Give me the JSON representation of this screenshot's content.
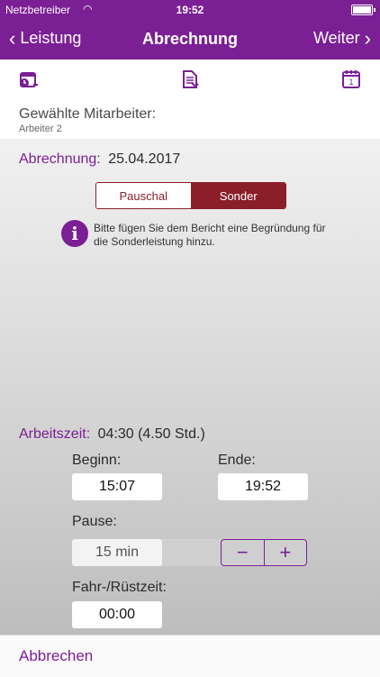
{
  "statusbar": {
    "carrier": "Netzbetreiber",
    "time": "19:52"
  },
  "nav": {
    "back_label": "Leistung",
    "title": "Abrechnung",
    "forward_label": "Weiter"
  },
  "toolbar": {
    "icons": [
      "calendar-clock-icon",
      "document-list-icon",
      "calendar-day-icon"
    ],
    "calendar_day_number": "1"
  },
  "selected_employees": {
    "label": "Gewählte Mitarbeiter:",
    "value": "Arbeiter 2"
  },
  "billing": {
    "label": "Abrechnung:",
    "date": "25.04.2017",
    "segments": [
      "Pauschal",
      "Sonder"
    ],
    "selected_segment": "Sonder",
    "info_text": "Bitte fügen Sie dem Bericht eine Begründung für die Sonderleistung hinzu."
  },
  "worktime": {
    "label": "Arbeitszeit:",
    "value": "04:30 (4.50 Std.)",
    "begin_label": "Beginn:",
    "begin_value": "15:07",
    "end_label": "Ende:",
    "end_value": "19:52",
    "pause_label": "Pause:",
    "pause_value": "15 min",
    "travel_label": "Fahr-/Rüstzeit:",
    "travel_value": "00:00"
  },
  "bottom": {
    "cancel_label": "Abbrechen"
  },
  "colors": {
    "primary": "#7b1f95",
    "accent_red": "#8a1f2a"
  }
}
